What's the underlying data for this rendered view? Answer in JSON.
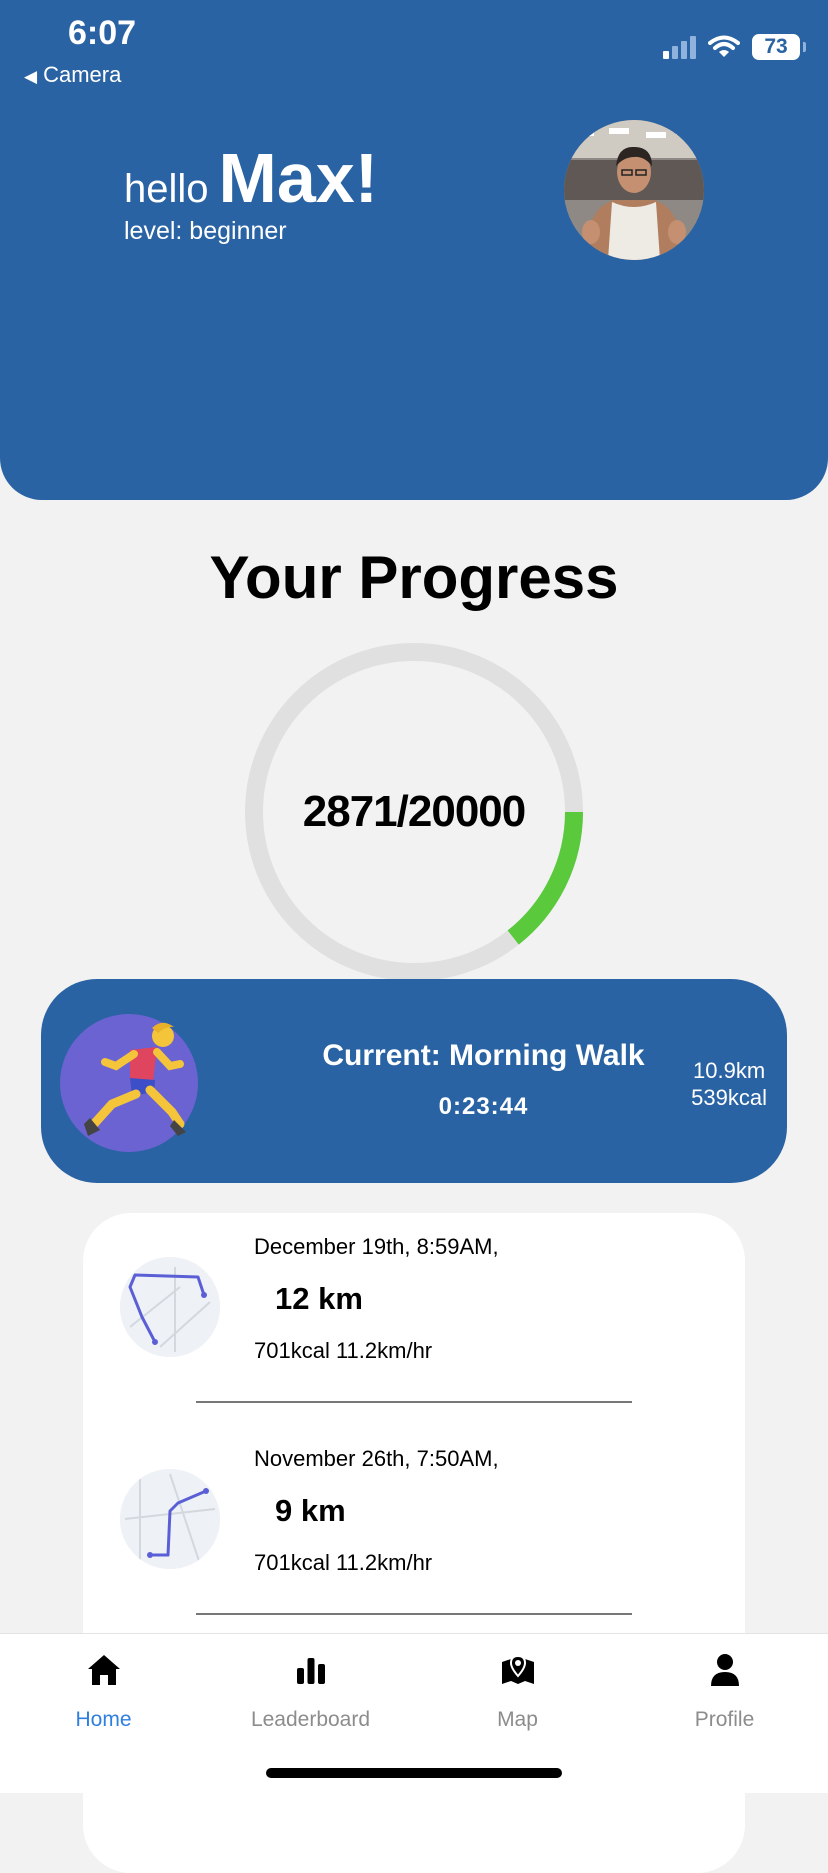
{
  "status_bar": {
    "time": "6:07",
    "back_label": "Camera",
    "battery": "73"
  },
  "header": {
    "hello": "hello",
    "name": "Max!",
    "level": "level: beginner"
  },
  "progress": {
    "title": "Your Progress",
    "steps": 2871,
    "goal": 20000,
    "label": "2871/20000",
    "ring_color": "#5ac93c"
  },
  "current": {
    "title": "Current: Morning Walk",
    "time": "0:23:44",
    "distance": "10.9km",
    "calories": "539kcal"
  },
  "history": [
    {
      "date": "December 19th, 8:59AM,",
      "distance": "12 km",
      "stats": "701kcal 11.2km/hr"
    },
    {
      "date": "November 26th, 7:50AM,",
      "distance": "9 km",
      "stats": "701kcal 11.2km/hr"
    }
  ],
  "tabs": [
    {
      "label": "Home",
      "icon": "home-icon",
      "active": true
    },
    {
      "label": "Leaderboard",
      "icon": "bar-chart-icon",
      "active": false
    },
    {
      "label": "Map",
      "icon": "map-pin-icon",
      "active": false
    },
    {
      "label": "Profile",
      "icon": "person-icon",
      "active": false
    }
  ],
  "colors": {
    "primary": "#2a63a3",
    "accent_tab": "#2f7fe0",
    "runner_bg": "#6b63d1",
    "route": "#5b5fd6"
  }
}
